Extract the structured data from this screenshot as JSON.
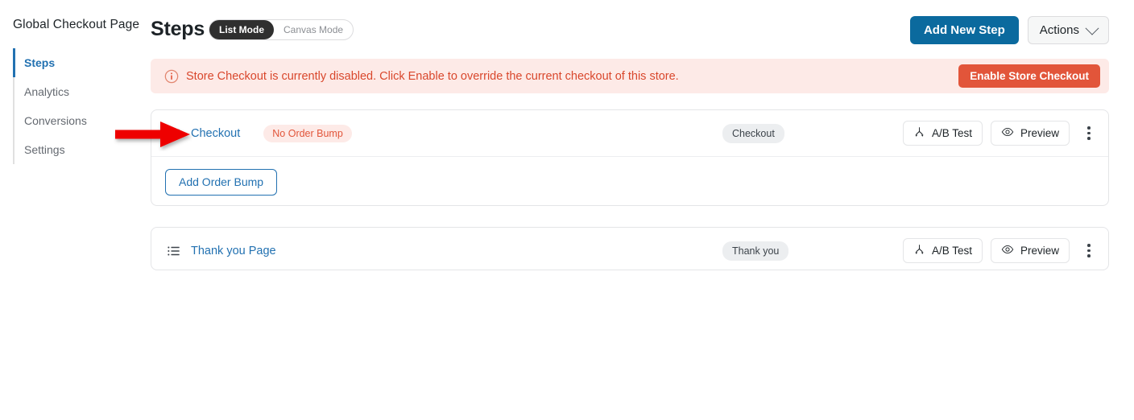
{
  "sidebar": {
    "title": "Global Checkout Page",
    "items": [
      {
        "label": "Steps",
        "active": true
      },
      {
        "label": "Analytics",
        "active": false
      },
      {
        "label": "Conversions",
        "active": false
      },
      {
        "label": "Settings",
        "active": false
      }
    ]
  },
  "header": {
    "page_title": "Steps",
    "mode_toggle": {
      "selected": "List Mode",
      "options": [
        "List Mode",
        "Canvas Mode"
      ]
    },
    "add_new_step_label": "Add New Step",
    "actions_label": "Actions"
  },
  "notice": {
    "icon": "info-circle-icon",
    "message": "Store Checkout is currently disabled. Click Enable to override the current checkout of this store.",
    "action_label": "Enable Store Checkout",
    "bg_color": "#fdeae7",
    "text_color": "#d9472c",
    "button_color": "#e2553a"
  },
  "steps": [
    {
      "drag_icon": "list-handle-icon",
      "name": "Checkout",
      "warn_badge": "No Order Bump",
      "type_badge": "Checkout",
      "ab_test_label": "A/B Test",
      "preview_label": "Preview",
      "kebab": "more-vertical-icon",
      "order_bump_button": "Add Order Bump"
    },
    {
      "drag_icon": "list-handle-icon",
      "name": "Thank you Page",
      "warn_badge": null,
      "type_badge": "Thank you",
      "ab_test_label": "A/B Test",
      "preview_label": "Preview",
      "kebab": "more-vertical-icon"
    }
  ],
  "annotation": {
    "type": "arrow",
    "color": "#ee0000",
    "points_to": "Checkout step name"
  },
  "colors": {
    "primary_blue": "#0b6a9e",
    "link_blue": "#2271b1",
    "danger": "#e2553a",
    "toggle_active_bg": "#2f2f2f"
  }
}
